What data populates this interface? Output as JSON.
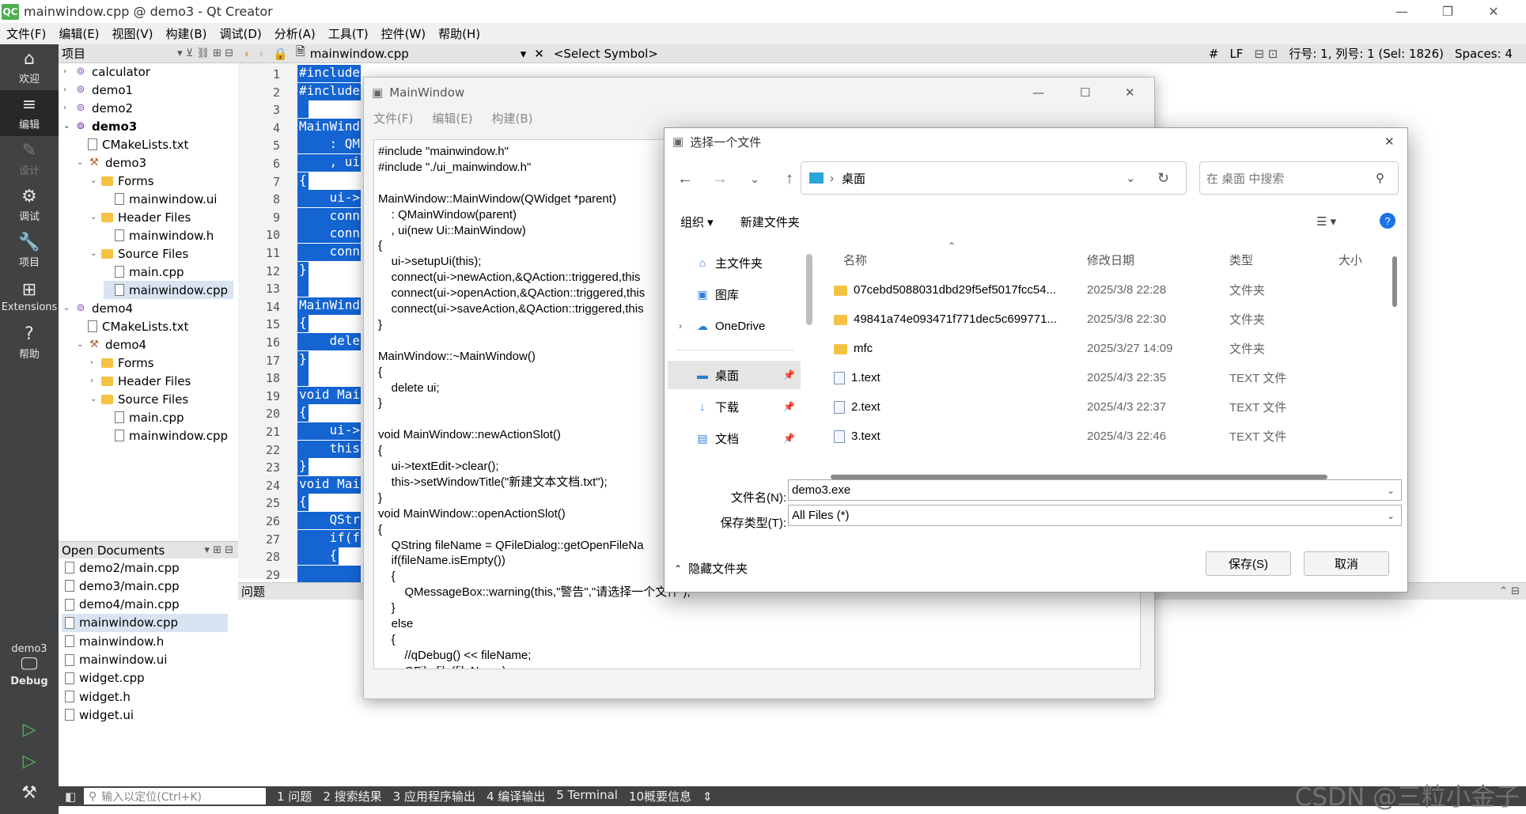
{
  "titlebar": {
    "logo": "QC",
    "title": "mainwindow.cpp @ demo3 - Qt Creator",
    "min": "—",
    "max": "❐",
    "close": "✕"
  },
  "menu": [
    "文件(F)",
    "编辑(E)",
    "视图(V)",
    "构建(B)",
    "调试(D)",
    "分析(A)",
    "工具(T)",
    "控件(W)",
    "帮助(H)"
  ],
  "modes": [
    {
      "icon": "⌂",
      "label": "欢迎"
    },
    {
      "icon": "≡",
      "label": "编辑"
    },
    {
      "icon": "✎",
      "label": "设计"
    },
    {
      "icon": "⚙",
      "label": "调试"
    },
    {
      "icon": "🔧",
      "label": "项目"
    },
    {
      "icon": "⊞",
      "label": "Extensions"
    },
    {
      "icon": "?",
      "label": "帮助"
    }
  ],
  "kit": {
    "project": "demo3",
    "config": "Debug"
  },
  "project_pane": {
    "title": "项目"
  },
  "project_tree": [
    {
      "label": "calculator",
      "indent": 0,
      "arrow": "›",
      "type": "proj"
    },
    {
      "label": "demo1",
      "indent": 0,
      "arrow": "›",
      "type": "proj"
    },
    {
      "label": "demo2",
      "indent": 0,
      "arrow": "›",
      "type": "proj"
    },
    {
      "label": "demo3",
      "indent": 0,
      "arrow": "⌄",
      "type": "proj",
      "bold": true
    },
    {
      "label": "CMakeLists.txt",
      "indent": 1,
      "arrow": "",
      "type": "file"
    },
    {
      "label": "demo3",
      "indent": 1,
      "arrow": "⌄",
      "type": "tool"
    },
    {
      "label": "Forms",
      "indent": 2,
      "arrow": "⌄",
      "type": "folder"
    },
    {
      "label": "mainwindow.ui",
      "indent": 3,
      "arrow": "",
      "type": "file"
    },
    {
      "label": "Header Files",
      "indent": 2,
      "arrow": "⌄",
      "type": "folder"
    },
    {
      "label": "mainwindow.h",
      "indent": 3,
      "arrow": "",
      "type": "file"
    },
    {
      "label": "Source Files",
      "indent": 2,
      "arrow": "⌄",
      "type": "folder"
    },
    {
      "label": "main.cpp",
      "indent": 3,
      "arrow": "",
      "type": "file"
    },
    {
      "label": "mainwindow.cpp",
      "indent": 3,
      "arrow": "",
      "type": "file",
      "selected": true
    },
    {
      "label": "demo4",
      "indent": 0,
      "arrow": "⌄",
      "type": "proj"
    },
    {
      "label": "CMakeLists.txt",
      "indent": 1,
      "arrow": "",
      "type": "file"
    },
    {
      "label": "demo4",
      "indent": 1,
      "arrow": "⌄",
      "type": "tool"
    },
    {
      "label": "Forms",
      "indent": 2,
      "arrow": "›",
      "type": "folder"
    },
    {
      "label": "Header Files",
      "indent": 2,
      "arrow": "›",
      "type": "folder"
    },
    {
      "label": "Source Files",
      "indent": 2,
      "arrow": "⌄",
      "type": "folder"
    },
    {
      "label": "main.cpp",
      "indent": 3,
      "arrow": "",
      "type": "file"
    },
    {
      "label": "mainwindow.cpp",
      "indent": 3,
      "arrow": "",
      "type": "file"
    }
  ],
  "open_documents": {
    "title": "Open Documents",
    "items": [
      "demo2/main.cpp",
      "demo3/main.cpp",
      "demo4/main.cpp",
      "mainwindow.cpp",
      "mainwindow.h",
      "mainwindow.ui",
      "widget.cpp",
      "widget.h",
      "widget.ui"
    ],
    "selected": "mainwindow.cpp"
  },
  "editor_bar": {
    "file": "mainwindow.cpp",
    "symbol": "<Select Symbol>",
    "hash": "#",
    "eol": "LF",
    "position": "行号: 1, 列号: 1 (Sel: 1826)",
    "spaces": "Spaces: 4"
  },
  "code_lines": [
    "#include \"mainwindow.h\"",
    "#include ",
    "",
    "MainWindo",
    "    : QMa",
    "    , ui",
    "{",
    "    ui->s",
    "    conne",
    "    conne",
    "    conne",
    "}",
    "",
    "MainWindo",
    "{",
    "    delet",
    "}",
    "",
    "void Main",
    "{",
    "    ui->",
    "    this",
    "}",
    "void Main",
    "{",
    "    QStri",
    "    if(fi",
    "    {",
    "        "
  ],
  "problems": {
    "title": "问题"
  },
  "statusbar": {
    "locate_placeholder": "输入以定位(Ctrl+K)",
    "items": [
      "1 问题",
      "2 搜索结果",
      "3 应用程序输出",
      "4 编译输出",
      "5 Terminal",
      "10概要信息"
    ]
  },
  "mainwindow": {
    "title": "MainWindow",
    "menu": [
      "文件(F)",
      "编辑(E)",
      "构建(B)"
    ],
    "text_lines": [
      "#include \"mainwindow.h\"",
      "#include \"./ui_mainwindow.h\"",
      "",
      "MainWindow::MainWindow(QWidget *parent)",
      "    : QMainWindow(parent)",
      "    , ui(new Ui::MainWindow)",
      "{",
      "    ui->setupUi(this);",
      "    connect(ui->newAction,&QAction::triggered,this",
      "    connect(ui->openAction,&QAction::triggered,this",
      "    connect(ui->saveAction,&QAction::triggered,this",
      "}",
      "",
      "MainWindow::~MainWindow()",
      "{",
      "    delete ui;",
      "}",
      "",
      "void MainWindow::newActionSlot()",
      "{",
      "    ui->textEdit->clear();",
      "    this->setWindowTitle(\"新建文本文档.txt\");",
      "}",
      "void MainWindow::openActionSlot()",
      "{",
      "    QString fileName = QFileDialog::getOpenFileNa",
      "    if(fileName.isEmpty())",
      "    {",
      "        QMessageBox::warning(this,\"警告\",\"请选择一个文件\");",
      "    }",
      "    else",
      "    {",
      "        //qDebug() << fileName;",
      "        QFile file(fileName);"
    ]
  },
  "file_dialog": {
    "title": "选择一个文件",
    "address": "桌面",
    "search_placeholder": "在 桌面 中搜索",
    "organize": "组织 ▾",
    "new_folder": "新建文件夹",
    "sidebar": [
      {
        "label": "主文件夹",
        "icon": "⌂"
      },
      {
        "label": "图库",
        "icon": "▣"
      },
      {
        "label": "OneDrive",
        "icon": "☁"
      },
      {
        "label": "桌面",
        "icon": "▬",
        "selected": true
      },
      {
        "label": "下载",
        "icon": "↓"
      },
      {
        "label": "文档",
        "icon": "▤"
      }
    ],
    "columns": {
      "name": "名称",
      "date": "修改日期",
      "type": "类型",
      "size": "大小"
    },
    "rows": [
      {
        "name": "07cebd5088031dbd29f5ef5017fcc54...",
        "date": "2025/3/8 22:28",
        "type": "文件夹",
        "kind": "folder"
      },
      {
        "name": "49841a74e093471f771dec5c699771...",
        "date": "2025/3/8 22:30",
        "type": "文件夹",
        "kind": "folder"
      },
      {
        "name": "mfc",
        "date": "2025/3/27 14:09",
        "type": "文件夹",
        "kind": "folder"
      },
      {
        "name": "1.text",
        "date": "2025/4/3 22:35",
        "type": "TEXT 文件",
        "kind": "text"
      },
      {
        "name": "2.text",
        "date": "2025/4/3 22:37",
        "type": "TEXT 文件",
        "kind": "text"
      },
      {
        "name": "3.text",
        "date": "2025/4/3 22:46",
        "type": "TEXT 文件",
        "kind": "text"
      }
    ],
    "filename_label": "文件名(N):",
    "filename_value": "demo3.exe",
    "filetype_label": "保存类型(T):",
    "filetype_value": "All Files (*)",
    "hide_folders": "隐藏文件夹",
    "save": "保存(S)",
    "cancel": "取消"
  },
  "watermark": "CSDN @三粒小金子"
}
